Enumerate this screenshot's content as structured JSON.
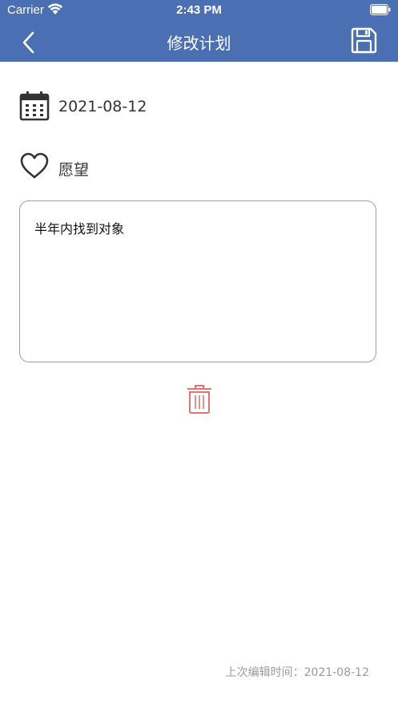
{
  "status_bar": {
    "carrier": "Carrier",
    "time": "2:43 PM"
  },
  "nav": {
    "title": "修改计划",
    "back_icon": "chevron-left-icon",
    "save_icon": "floppy-disk-icon",
    "background_color": "#4a6fb3"
  },
  "plan": {
    "date": "2021-08-12",
    "date_icon": "calendar-icon",
    "type": "愿望",
    "type_icon": "heart-icon",
    "content": "半年内找到对象"
  },
  "actions": {
    "delete_icon": "trash-icon",
    "delete_color": "#e57373"
  },
  "footer": {
    "last_edit": "上次编辑时间：2021-08-12"
  }
}
